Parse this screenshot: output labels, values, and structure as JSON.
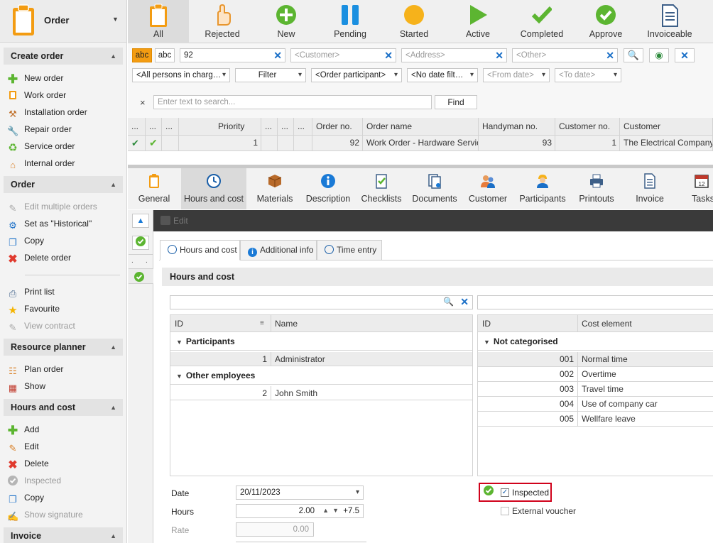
{
  "sidebar": {
    "title": "Order",
    "sections": [
      {
        "title": "Create order",
        "items": [
          {
            "label": "New order",
            "icon": "plus-icon"
          },
          {
            "label": "Work order",
            "icon": "clipboard-icon"
          },
          {
            "label": "Installation order",
            "icon": "hammer-icon"
          },
          {
            "label": "Repair order",
            "icon": "wrench-icon"
          },
          {
            "label": "Service order",
            "icon": "recycle-icon"
          },
          {
            "label": "Internal order",
            "icon": "house-icon"
          }
        ]
      },
      {
        "title": "Order",
        "items": [
          {
            "label": "Edit multiple orders",
            "icon": "edit-icon",
            "disabled": true
          },
          {
            "label": "Set as \"Historical\"",
            "icon": "historical-icon"
          },
          {
            "label": "Copy",
            "icon": "copy-icon"
          },
          {
            "label": "Delete order",
            "icon": "delete-icon"
          },
          {
            "label": "Print list",
            "icon": "printer-icon"
          },
          {
            "label": "Favourite",
            "icon": "star-icon"
          },
          {
            "label": "View contract",
            "icon": "contract-icon",
            "disabled": true
          }
        ]
      },
      {
        "title": "Resource planner",
        "items": [
          {
            "label": "Plan order",
            "icon": "plan-icon"
          },
          {
            "label": "Show",
            "icon": "calendar-icon"
          }
        ]
      },
      {
        "title": "Hours and cost",
        "items": [
          {
            "label": "Add",
            "icon": "plus-icon"
          },
          {
            "label": "Edit",
            "icon": "edit-icon"
          },
          {
            "label": "Delete",
            "icon": "delete-icon"
          },
          {
            "label": "Inspected",
            "icon": "check-circle-icon",
            "disabled": true
          },
          {
            "label": "Copy",
            "icon": "copy-icon"
          },
          {
            "label": "Show signature",
            "icon": "signature-icon",
            "disabled": true
          }
        ]
      },
      {
        "title": "Invoice",
        "items": []
      }
    ]
  },
  "toolbar": {
    "buttons": [
      {
        "label": "All",
        "icon": "clipboard-icon",
        "active": true
      },
      {
        "label": "Rejected",
        "icon": "rejected-hand-icon"
      },
      {
        "label": "New",
        "icon": "plus-circle-icon"
      },
      {
        "label": "Pending",
        "icon": "pause-icon"
      },
      {
        "label": "Started",
        "icon": "started-circle-icon"
      },
      {
        "label": "Active",
        "icon": "play-icon"
      },
      {
        "label": "Completed",
        "icon": "checkmark-icon"
      },
      {
        "label": "Approve",
        "icon": "approve-circle-icon"
      },
      {
        "label": "Invoiceable",
        "icon": "invoice-doc-icon"
      }
    ]
  },
  "filters": {
    "abc1": "abc",
    "abc2": "abc",
    "search_value": "92",
    "customer_placeholder": "<Customer>",
    "address_placeholder": "<Address>",
    "other_placeholder": "<Other>",
    "persons": "<All persons in charg…",
    "filter": "Filter",
    "participant": "<Order participant>",
    "date_filter": "<No date filt…",
    "from_date": "<From date>",
    "to_date": "<To date>"
  },
  "search": {
    "placeholder": "Enter text to search...",
    "find_label": "Find"
  },
  "orders_grid": {
    "columns": [
      "...",
      "...",
      "...",
      "Priority",
      "...",
      "...",
      "...",
      "Order no.",
      "Order name",
      "Handyman no.",
      "Customer no.",
      "Customer"
    ],
    "rows": [
      {
        "priority": "1",
        "order_no": "92",
        "order_name": "Work Order - Hardware Service",
        "handyman_no": "93",
        "customer_no": "1",
        "customer": "The Electrical Company"
      }
    ]
  },
  "detail_tabs": [
    {
      "label": "General",
      "icon": "clipboard-icon"
    },
    {
      "label": "Hours and cost",
      "icon": "clock-icon",
      "active": true
    },
    {
      "label": "Materials",
      "icon": "box-icon"
    },
    {
      "label": "Description",
      "icon": "info-icon"
    },
    {
      "label": "Checklists",
      "icon": "checklist-icon"
    },
    {
      "label": "Documents",
      "icon": "documents-icon"
    },
    {
      "label": "Customer",
      "icon": "people-icon"
    },
    {
      "label": "Participants",
      "icon": "worker-icon"
    },
    {
      "label": "Printouts",
      "icon": "printer-icon"
    },
    {
      "label": "Invoice",
      "icon": "invoice-doc-icon"
    },
    {
      "label": "Tasks",
      "icon": "calendar-icon"
    }
  ],
  "edit_bar": {
    "label": "Edit"
  },
  "inner_tabs": [
    {
      "label": "Hours and cost",
      "active": true
    },
    {
      "label": "Additional info"
    },
    {
      "label": "Time entry"
    }
  ],
  "panel": {
    "title": "Hours and cost",
    "employees": {
      "col_id": "ID",
      "col_name": "Name",
      "groups": [
        {
          "name": "Participants",
          "rows": [
            {
              "id": "1",
              "name": "Administrator"
            }
          ]
        },
        {
          "name": "Other employees",
          "rows": [
            {
              "id": "2",
              "name": "John Smith"
            }
          ]
        }
      ]
    },
    "cost_elements": {
      "col_id": "ID",
      "col_name": "Cost element",
      "group": "Not categorised",
      "rows": [
        {
          "id": "001",
          "name": "Normal time"
        },
        {
          "id": "002",
          "name": "Overtime"
        },
        {
          "id": "003",
          "name": "Travel time"
        },
        {
          "id": "004",
          "name": "Use of company car"
        },
        {
          "id": "005",
          "name": "Wellfare leave"
        }
      ]
    },
    "form": {
      "date_label": "Date",
      "date_value": "20/11/2023",
      "hours_label": "Hours",
      "hours_value": "2.00",
      "hours_step": "+7.5",
      "rate_label": "Rate",
      "rate_value": "0.00",
      "inspected_label": "Inspected",
      "inspected_checked": true,
      "external_voucher_label": "External voucher",
      "external_voucher_checked": false
    }
  },
  "colors": {
    "accent_orange": "#f39c12",
    "green": "#5cb531",
    "blue": "#1a7ad6",
    "highlight_red": "#d0021b"
  }
}
